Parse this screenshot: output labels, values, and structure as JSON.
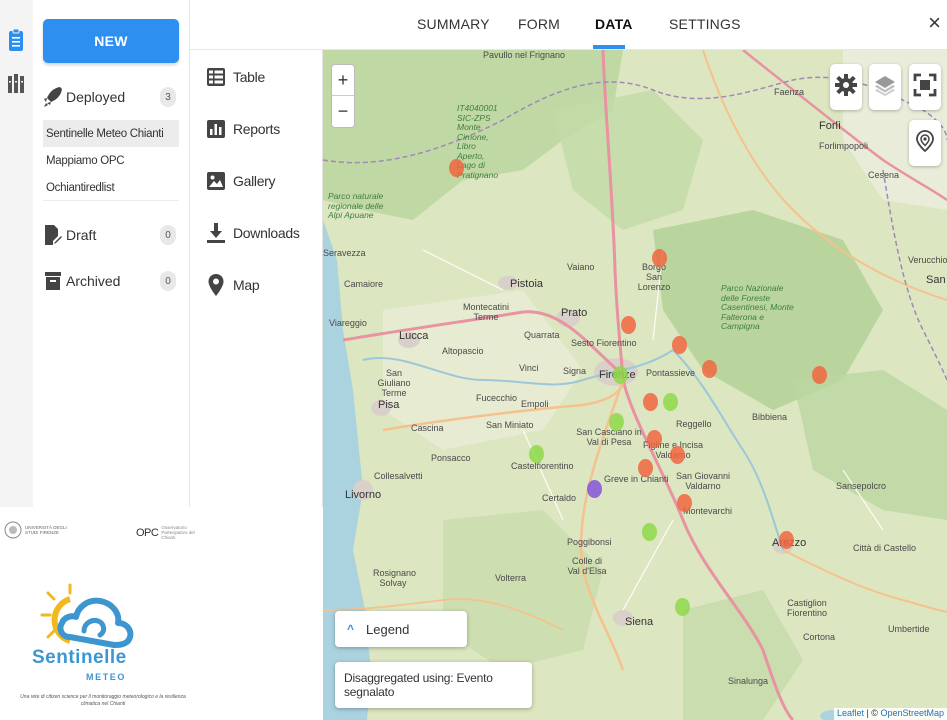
{
  "header": {
    "tabs": [
      {
        "label": "SUMMARY",
        "active": false
      },
      {
        "label": "FORM",
        "active": false
      },
      {
        "label": "DATA",
        "active": true
      },
      {
        "label": "SETTINGS",
        "active": false
      }
    ],
    "close_label": "×"
  },
  "rail": {
    "icons": [
      "clipboard-icon",
      "library-icon"
    ]
  },
  "sidebar": {
    "new_label": "NEW",
    "deployed": {
      "label": "Deployed",
      "count": "3"
    },
    "projects": [
      "Sentinelle Meteo Chianti",
      "Mappiamo OPC",
      "Ochiantiredlist"
    ],
    "draft": {
      "label": "Draft",
      "count": "0"
    },
    "archived": {
      "label": "Archived",
      "count": "0"
    }
  },
  "subnav": {
    "items": [
      {
        "label": "Table",
        "icon": "table-icon"
      },
      {
        "label": "Reports",
        "icon": "bar-chart-icon"
      },
      {
        "label": "Gallery",
        "icon": "image-icon"
      },
      {
        "label": "Downloads",
        "icon": "download-icon"
      },
      {
        "label": "Map",
        "icon": "map-pin-icon"
      }
    ]
  },
  "map": {
    "zoom_in": "+",
    "zoom_out": "−",
    "legend_label": "Legend",
    "disaggregation": "Disaggregated using: Evento segnalato",
    "attribution_leaflet": "Leaflet",
    "attribution_sep": " | © ",
    "attribution_osm": "OpenStreetMap",
    "places": [
      "Pavullo nel Frignano",
      "Faenza",
      "Forlì",
      "Forlimpopoli",
      "Cesena",
      "Seravezza",
      "Camaiore",
      "Viareggio",
      "Lucca",
      "Altopascio",
      "Pistoia",
      "Montecatini Terme",
      "Quarrata",
      "Prato",
      "Vaiano",
      "Borgo San Lorenzo",
      "Sesto Fiorentino",
      "Firenze",
      "Pontassieve",
      "Signa",
      "Vinci",
      "Empoli",
      "Fucecchio",
      "San Giuliano Terme",
      "Pisa",
      "Cascina",
      "San Miniato",
      "Ponsacco",
      "Collesalvetti",
      "Livorno",
      "Castelfiorentino",
      "Certaldo",
      "San Casciano in Val di Pesa",
      "Figline e Incisa Valdarno",
      "Reggello",
      "Greve in Chianti",
      "San Giovanni Valdarno",
      "Montevarchi",
      "Poggibonsi",
      "Colle di Val d'Elsa",
      "Volterra",
      "Siena",
      "Arezzo",
      "Bibbiena",
      "Sansepolcro",
      "Città di Castello",
      "Castiglion Fiorentino",
      "Cortona",
      "Umbertide",
      "Rosignano Solvay",
      "Sinalunga",
      "Verucchio",
      "San Ma"
    ],
    "parks": [
      "IT4040001 SIC-ZPS Monte Cimone, Libro Aperto, Lago di Pratignano",
      "Parco naturale regionale delle Alpi Apuane",
      "Parco Nazionale delle Foreste Casentinesi, Monte Falterona e Campigna"
    ],
    "marker_colors": {
      "red": "#f0663f",
      "green": "#8fd84a",
      "purple": "#8a5cd6"
    }
  },
  "branding": {
    "university": "UNIVERSITÀ DEGLI STUDI FIRENZE",
    "opc_logo": "OPC",
    "opc_text": "Osservatorio Partecipativo del Chianti",
    "logo_word": "Sentinelle",
    "logo_sub": "METEO",
    "tagline": "Una rete di citizen science per il monitoraggio meteorologico e la resilienza climatica nel Chianti"
  }
}
